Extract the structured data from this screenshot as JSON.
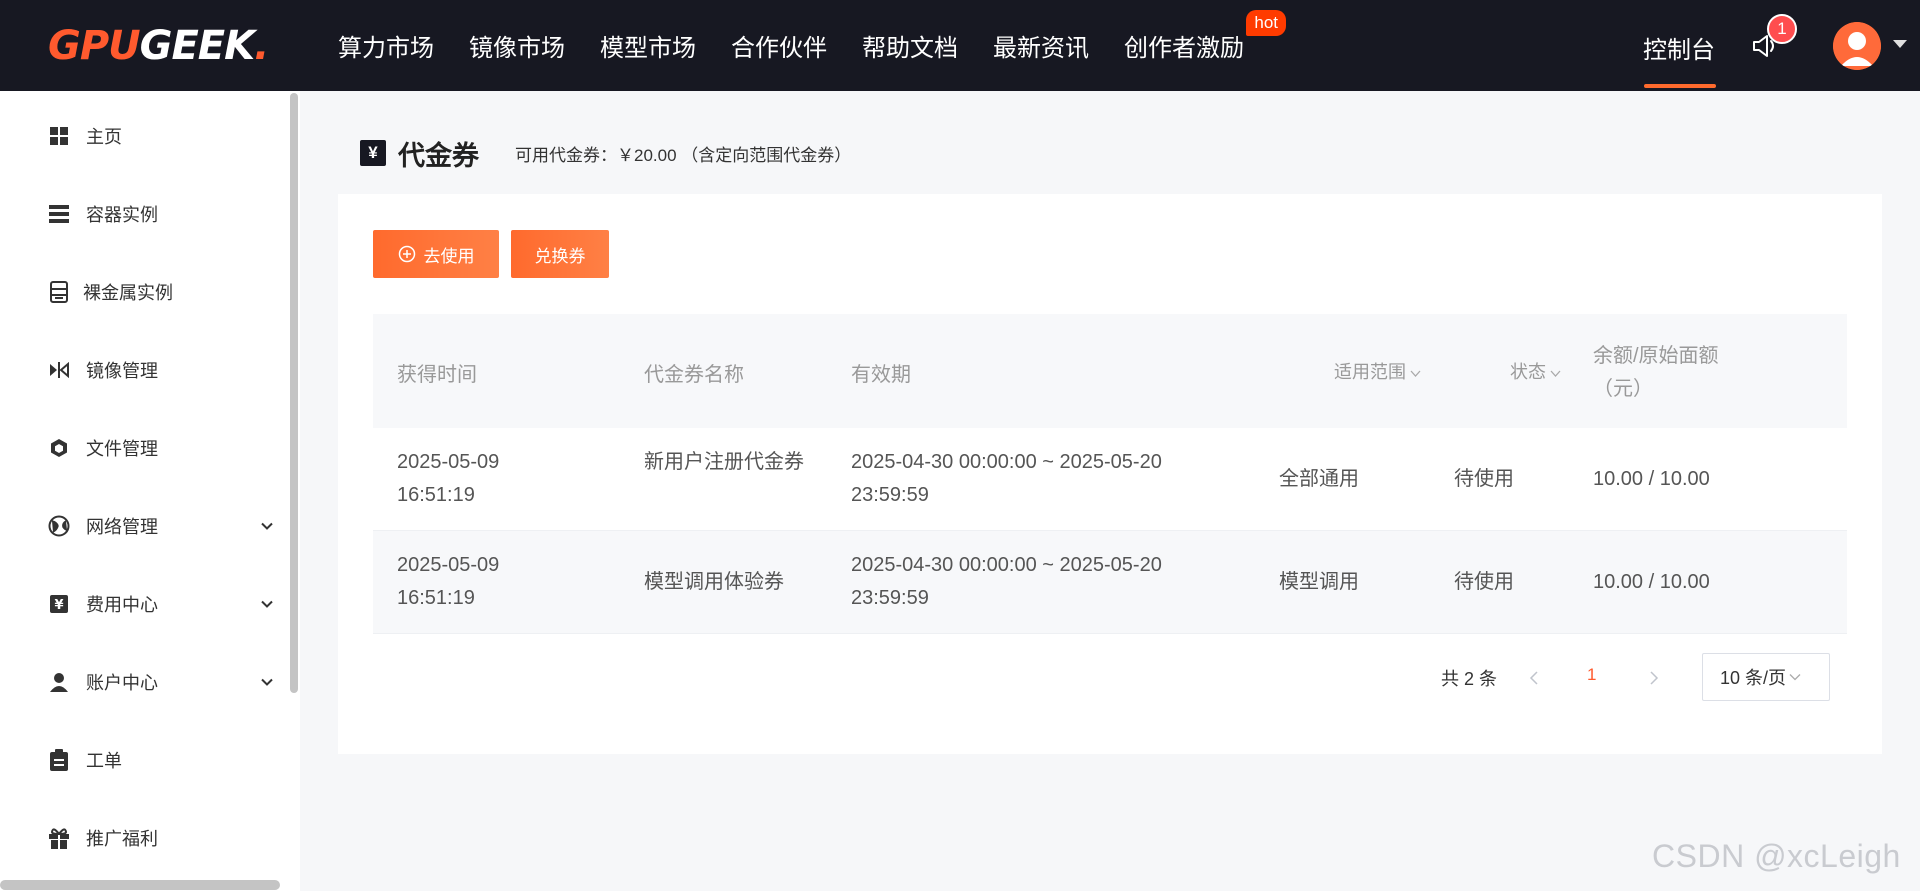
{
  "header": {
    "logo": {
      "part1": "GPU",
      "part2": "GEEK",
      "dot": "."
    },
    "nav": [
      "算力市场",
      "镜像市场",
      "模型市场",
      "合作伙伴",
      "帮助文档",
      "最新资讯",
      "创作者激励"
    ],
    "hot_badge": "hot",
    "console": "控制台",
    "notification_count": "1"
  },
  "sidebar": {
    "items": [
      {
        "label": "主页",
        "icon": "grid-icon"
      },
      {
        "label": "容器实例",
        "icon": "server-icon"
      },
      {
        "label": "裸金属实例",
        "icon": "machine-icon"
      },
      {
        "label": "镜像管理",
        "icon": "image-icon"
      },
      {
        "label": "文件管理",
        "icon": "box-icon"
      },
      {
        "label": "网络管理",
        "icon": "globe-icon"
      },
      {
        "label": "费用中心",
        "icon": "yen-icon"
      },
      {
        "label": "账户中心",
        "icon": "user-icon"
      },
      {
        "label": "工单",
        "icon": "clipboard-icon"
      },
      {
        "label": "推广福利",
        "icon": "gift-icon"
      }
    ]
  },
  "page": {
    "yen_symbol": "¥",
    "title": "代金券",
    "available": "可用代金券：￥20.00 （含定向范围代金券）",
    "use_button": "去使用",
    "redeem_button": "兑换券"
  },
  "table": {
    "headers": {
      "time": "获得时间",
      "name": "代金券名称",
      "valid": "有效期",
      "scope": "适用范围",
      "status": "状态",
      "amount_line1": "余额/原始面额",
      "amount_line2": "（元）"
    },
    "rows": [
      {
        "time": "2025-05-09 16:51:19",
        "name": "新用户注册代金券",
        "valid": "2025-04-30 00:00:00 ~ 2025-05-20 23:59:59",
        "scope": "全部通用",
        "status": "待使用",
        "amount": "10.00 / 10.00"
      },
      {
        "time": "2025-05-09 16:51:19",
        "name": "模型调用体验券",
        "valid": "2025-04-30 00:00:00 ~ 2025-05-20 23:59:59",
        "scope": "模型调用",
        "status": "待使用",
        "amount": "10.00 / 10.00"
      }
    ]
  },
  "pagination": {
    "total": "共 2 条",
    "current": "1",
    "page_size": "10 条/页"
  },
  "watermark": "CSDN @xcLeigh",
  "colors": {
    "accent": "#ff5a2e",
    "nav_bg": "#171822",
    "badge": "#ff4d4f"
  }
}
